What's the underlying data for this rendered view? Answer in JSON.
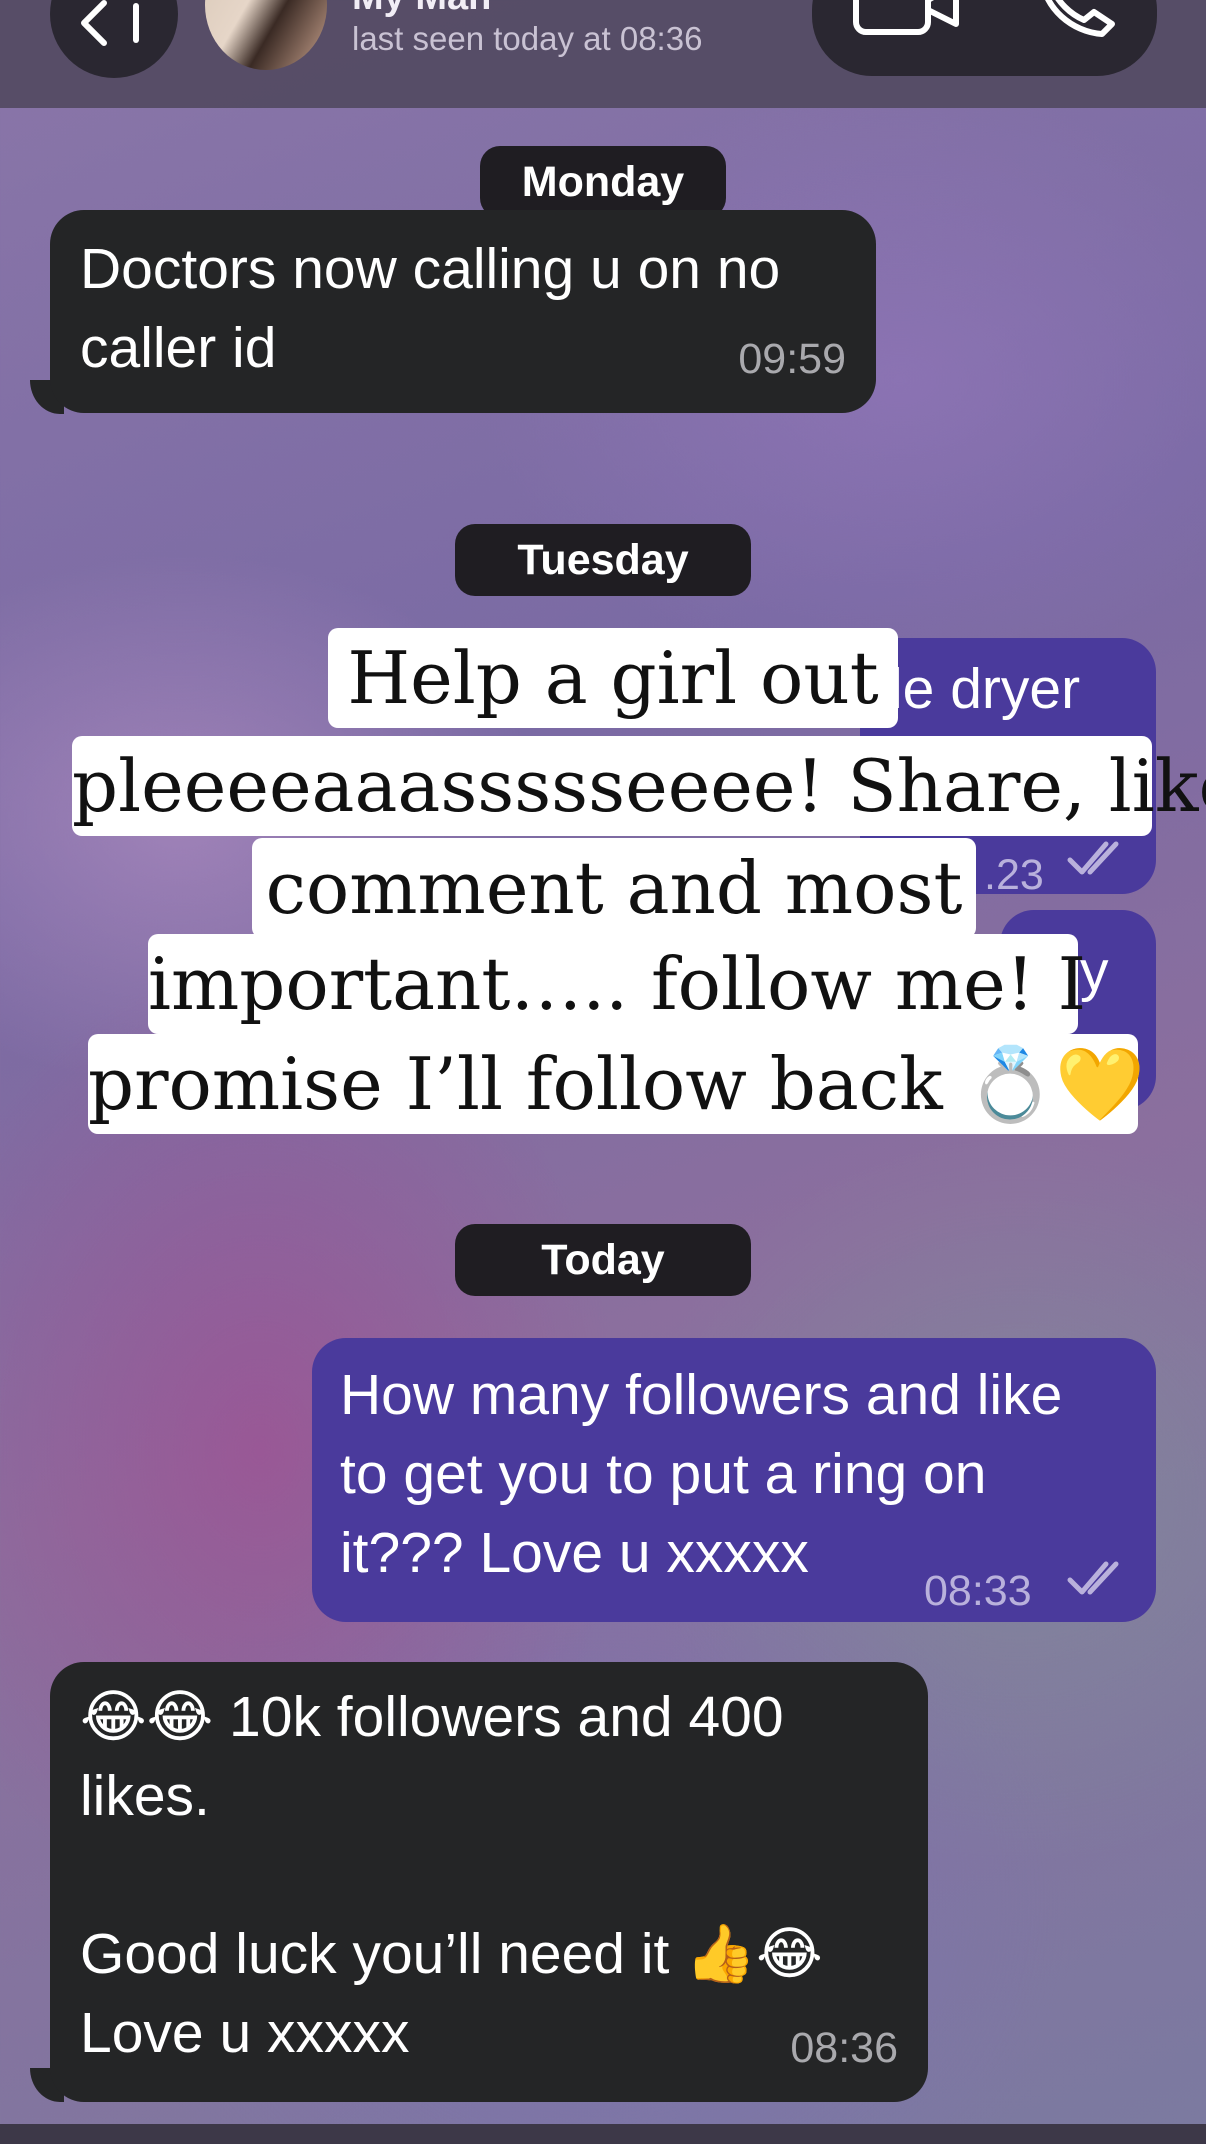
{
  "header": {
    "contact_name": "My Man",
    "last_seen": "last seen today at 08:36",
    "icons": [
      "back-icon",
      "video-call-icon",
      "phone-icon"
    ]
  },
  "dates": {
    "monday": "Monday",
    "tuesday": "Tuesday",
    "today": "Today"
  },
  "messages": {
    "m1": {
      "text": "Doctors now calling u on no\ncaller id",
      "time": "09:59"
    },
    "m2": {
      "text": "le dryer",
      "time": ".23"
    },
    "m3": {
      "text": "y"
    },
    "m4": {
      "text": "How many followers and like\nto get you to put a ring on\nit??? Love u xxxxx",
      "time": "08:33"
    },
    "m5": {
      "text": "😂😂 10k followers and 400\nlikes.\n\nGood luck you’ll need it 👍😂\nLove u xxxxx",
      "time": "08:36"
    }
  },
  "overlay": {
    "line1": "Help a girl out",
    "line2": "pleeeeaaassssseeee! Share, like,",
    "line3": "comment and most",
    "line4": "important….. follow me! I",
    "line5": "promise I’ll follow back 💍💛"
  },
  "colors": {
    "incoming_bubble": "#242526",
    "outgoing_bubble": "#4a3a9c",
    "header_bg": "#524a62"
  }
}
